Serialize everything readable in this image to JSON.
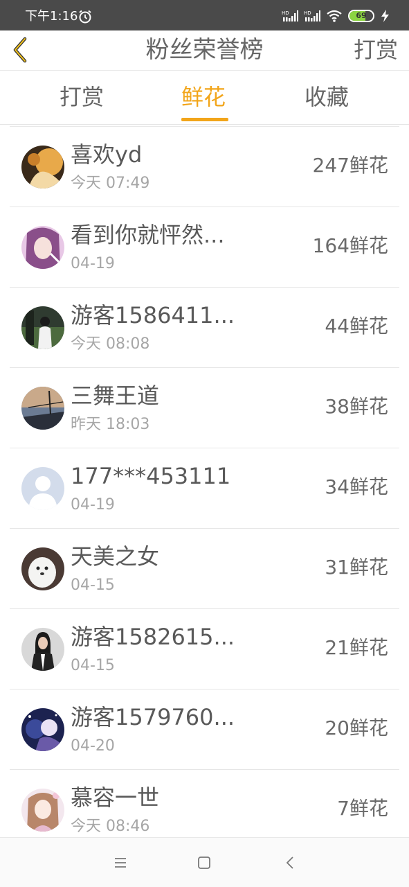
{
  "status_bar": {
    "time": "下午1:16",
    "battery_level": 69,
    "battery_text": "69",
    "signal_labels": [
      "HD",
      "HD"
    ]
  },
  "header": {
    "title": "粉丝荣誉榜",
    "action_label": "打赏",
    "back_icon": "chevron-left-icon"
  },
  "tabs": [
    {
      "label": "打赏",
      "active": false
    },
    {
      "label": "鲜花",
      "active": true
    },
    {
      "label": "收藏",
      "active": false
    }
  ],
  "accent_color": "#f2a51a",
  "fans": [
    {
      "name": "喜欢yd",
      "date": "今天 07:49",
      "count": "247鲜花"
    },
    {
      "name": "看到你就怦然...",
      "date": "04-19",
      "count": "164鲜花"
    },
    {
      "name": "游客1586411...",
      "date": "今天 08:08",
      "count": "44鲜花"
    },
    {
      "name": "三舞王道",
      "date": "昨天 18:03",
      "count": "38鲜花"
    },
    {
      "name": "177***453111",
      "date": "04-19",
      "count": "34鲜花"
    },
    {
      "name": "天美之女",
      "date": "04-15",
      "count": "31鲜花"
    },
    {
      "name": "游客1582615...",
      "date": "04-15",
      "count": "21鲜花"
    },
    {
      "name": "游客1579760...",
      "date": "04-20",
      "count": "20鲜花"
    },
    {
      "name": "慕容一世",
      "date": "今天 08:46",
      "count": "7鲜花"
    }
  ],
  "nav": [
    "menu-icon",
    "home-icon",
    "back-icon"
  ]
}
